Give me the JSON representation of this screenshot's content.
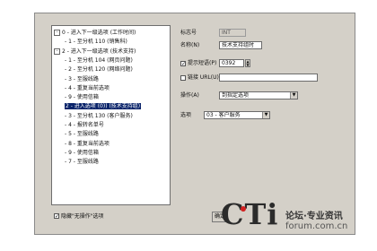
{
  "tree": {
    "items": [
      {
        "expander": "-",
        "text": "0 - 进入下一级选项 (工作时间)"
      },
      {
        "expander": "",
        "text": "- 1 - 至分机 110 (销售科)"
      },
      {
        "expander": "-",
        "text": "2 - 进入下一级选项 (技术支持)"
      },
      {
        "expander": "",
        "text": "- 1 - 至分机 104 (网页问题)"
      },
      {
        "expander": "",
        "text": "- 2 - 至分机 120 (网络问题)"
      },
      {
        "expander": "",
        "text": "- 3 - 至服线路"
      },
      {
        "expander": "",
        "text": "- 4 - 重复当前选项"
      },
      {
        "expander": "",
        "text": "- 9 - 使用信箱"
      },
      {
        "expander": "",
        "text": "2 - 进入选项 (0)) (技术支持组)"
      },
      {
        "expander": "",
        "text": "- 3 - 至分机 130 (客户服务)"
      },
      {
        "expander": "",
        "text": "- 4 - 报转名单号"
      },
      {
        "expander": "",
        "text": "- 5 - 至服线路"
      },
      {
        "expander": "",
        "text": "- 8 - 重复当前选项"
      },
      {
        "expander": "",
        "text": "- 9 - 使用信箱"
      },
      {
        "expander": "",
        "text": "- 7 - 至服线路"
      }
    ],
    "selected_index": 8
  },
  "form": {
    "tag_label": "标志号",
    "tag_value": "INT",
    "name_label": "名称(N)",
    "name_value": "技术支持组时",
    "prompt_label": "提示短语(P)",
    "prompt_value": "0392",
    "prompt_checked": "✓",
    "link_label": "链接 URL(U)",
    "link_value": "",
    "action_label": "操作(A)",
    "action_value": "到指定选项",
    "option_label": "选项",
    "option_value": "03 - 客户服务"
  },
  "bottom": {
    "hide_checkbox_label": "隐藏\"无操作\"选项",
    "hide_checked": "✓",
    "button_label": "确定"
  },
  "watermark": {
    "brand": "CTi",
    "line1": "论坛·专业资讯",
    "line2": "forum.com.cn"
  },
  "colors": {
    "dialog_bg": "#d4d0c8",
    "selection": "#0a246a",
    "watermark_dot": "#d21f1f"
  }
}
